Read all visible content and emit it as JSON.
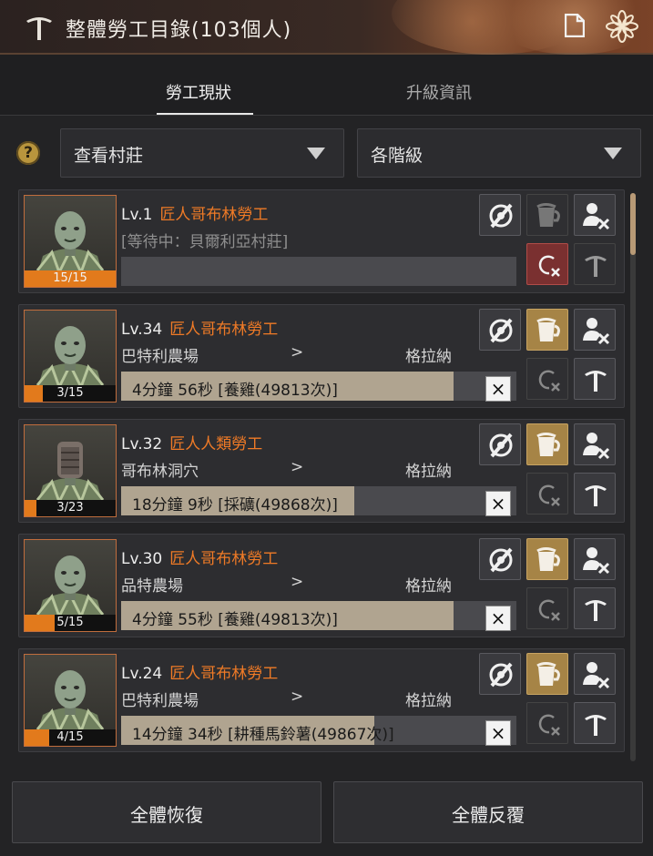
{
  "window": {
    "title": "整體勞工目錄(103個人)"
  },
  "tabs": [
    {
      "label": "勞工現狀",
      "active": true
    },
    {
      "label": "升級資訊",
      "active": false
    }
  ],
  "filters": {
    "help_icon": "?",
    "village": "查看村莊",
    "tier": "各階級"
  },
  "workers": [
    {
      "level": "Lv.1",
      "name": "匠人哥布林勞工",
      "status": "[等待中：貝爾利亞村莊]",
      "location": "",
      "town": "",
      "task": "",
      "stamina": "15/15",
      "stamina_fraction": 1.0,
      "task_progress": 0,
      "idle": true
    },
    {
      "level": "Lv.34",
      "name": "匠人哥布林勞工",
      "status": "",
      "location": "巴特利農場",
      "arrow": ">",
      "town": "格拉納",
      "task": "4分鐘 56秒 [養雞(49813次)]",
      "stamina": "3/15",
      "stamina_fraction": 0.2,
      "task_progress": 0.84,
      "idle": false
    },
    {
      "level": "Lv.32",
      "name": "匠人人類勞工",
      "status": "",
      "location": "哥布林洞穴",
      "arrow": ">",
      "town": "格拉納",
      "task": "18分鐘 9秒 [採礦(49868次)]",
      "stamina": "3/23",
      "stamina_fraction": 0.13,
      "task_progress": 0.59,
      "idle": false
    },
    {
      "level": "Lv.30",
      "name": "匠人哥布林勞工",
      "status": "",
      "location": "品特農場",
      "arrow": ">",
      "town": "格拉納",
      "task": "4分鐘 55秒 [養雞(49813次)]",
      "stamina": "5/15",
      "stamina_fraction": 0.33,
      "task_progress": 0.84,
      "idle": false
    },
    {
      "level": "Lv.24",
      "name": "匠人哥布林勞工",
      "status": "",
      "location": "巴特利農場",
      "arrow": ">",
      "town": "格拉納",
      "task": "14分鐘 34秒 [耕種馬鈴薯(49867次)]",
      "stamina": "4/15",
      "stamina_fraction": 0.27,
      "task_progress": 0.64,
      "idle": false
    }
  ],
  "actions": {
    "recover_all": "全體恢復",
    "repeat_all": "全體反覆"
  },
  "icons": [
    "pickaxe-icon",
    "document-icon",
    "flower-icon",
    "help-icon",
    "dropdown-arrow-icon",
    "hide-icon",
    "beer-icon",
    "fire-worker-icon",
    "stop-repeat-icon",
    "upgrade-icon",
    "cancel-icon"
  ],
  "colors": {
    "worker_name": "#ef7a26",
    "stamina": "#e27a1c",
    "gold_button": "#a68446",
    "red_button": "#7a3030"
  }
}
